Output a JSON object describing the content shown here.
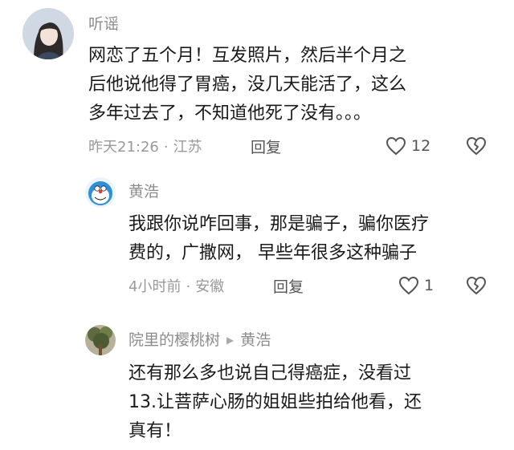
{
  "comments": [
    {
      "username": "听谣",
      "lines": [
        "网恋了五个月！互发照片，然后半个月之",
        "后他说他得了胃癌，没几天能活了，这么",
        "多年过去了，不知道他死了没有。。。"
      ],
      "time": "昨天21:26",
      "location": "江苏",
      "reply_label": "回复",
      "likes": "12"
    },
    {
      "username": "黄浩",
      "lines": [
        "我跟你说咋回事，那是骗子，骗你医疗",
        "费的，广撒网，  早些年很多这种骗子"
      ],
      "time": "4小时前",
      "location": "安徽",
      "reply_label": "回复",
      "likes": "1"
    },
    {
      "username": "院里的樱桃树",
      "reply_to": "黄浩",
      "lines": [
        "还有那么多也说自己得癌症，没看过",
        "13.让菩萨心肠的姐姐些拍给他看，还",
        "真有！"
      ]
    }
  ],
  "separator": "·",
  "reply_arrow": "▶",
  "icons": {
    "like": "heart-outline-icon",
    "dislike": "broken-heart-icon"
  }
}
